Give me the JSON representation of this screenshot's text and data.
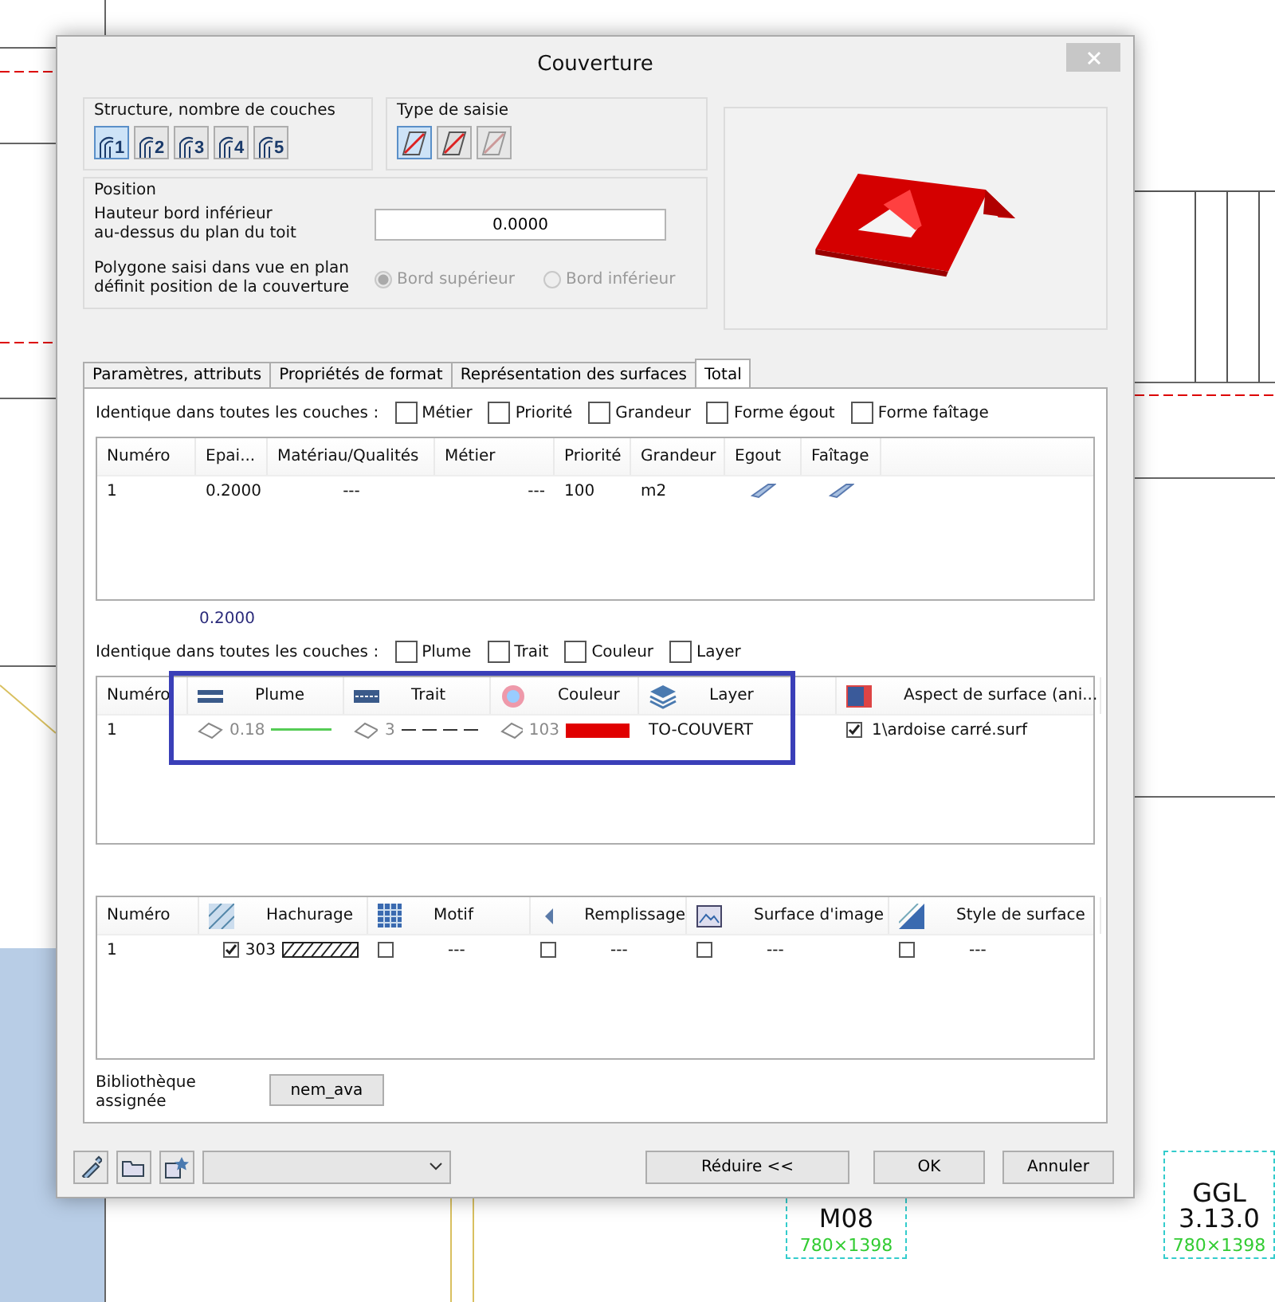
{
  "window": {
    "title": "Couverture"
  },
  "structure": {
    "label": "Structure, nombre de couches",
    "buttons": [
      {
        "label": "1",
        "selected": true
      },
      {
        "label": "2",
        "selected": false
      },
      {
        "label": "3",
        "selected": false
      },
      {
        "label": "4",
        "selected": false
      },
      {
        "label": "5",
        "selected": false
      }
    ]
  },
  "entry_type": {
    "label": "Type de saisie",
    "buttons": [
      {
        "selected": true,
        "disabled": false
      },
      {
        "selected": false,
        "disabled": false
      },
      {
        "selected": false,
        "disabled": true
      }
    ]
  },
  "position": {
    "label": "Position",
    "height_label": "Hauteur bord inférieur\nau-dessus du plan du toit",
    "height_value": "0.0000",
    "polygon_label": "Polygone saisi dans vue en plan\ndéfinit position de la couverture",
    "disabled": true,
    "radios": [
      {
        "label": "Bord supérieur",
        "selected": true
      },
      {
        "label": "Bord inférieur",
        "selected": false
      }
    ]
  },
  "tabs": [
    {
      "label": "Paramètres, attributs",
      "selected": false
    },
    {
      "label": "Propriétés de format",
      "selected": false
    },
    {
      "label": "Représentation des surfaces",
      "selected": false
    },
    {
      "label": "Total",
      "selected": true
    }
  ],
  "identical_1": {
    "label": "Identique dans toutes les couches :",
    "options": [
      {
        "label": "Métier",
        "checked": false
      },
      {
        "label": "Priorité",
        "checked": false
      },
      {
        "label": "Grandeur",
        "checked": false
      },
      {
        "label": "Forme égout",
        "checked": false
      },
      {
        "label": "Forme faîtage",
        "checked": false
      }
    ]
  },
  "layers_table": {
    "columns": [
      "Numéro",
      "Epai...",
      "Matériau/Qualités",
      "Métier",
      "Priorité",
      "Grandeur",
      "Egout",
      "Faîtage"
    ],
    "rows": [
      [
        {
          "kind": "text",
          "text": "1"
        },
        {
          "kind": "text",
          "text": "0.2000"
        },
        {
          "kind": "center",
          "text": "---"
        },
        {
          "kind": "right",
          "text": "---"
        },
        {
          "kind": "text",
          "text": "100"
        },
        {
          "kind": "text",
          "text": "m2"
        },
        {
          "kind": "shape"
        },
        {
          "kind": "shape"
        }
      ]
    ]
  },
  "total": "0.2000",
  "identical_2": {
    "label": "Identique dans toutes les couches :",
    "options": [
      {
        "label": "Plume",
        "checked": false
      },
      {
        "label": "Trait",
        "checked": false
      },
      {
        "label": "Couleur",
        "checked": false
      },
      {
        "label": "Layer",
        "checked": false
      }
    ]
  },
  "format_table": {
    "columns": [
      "Numéro",
      "Plume",
      "Trait",
      "Couleur",
      "Layer",
      "Aspect de surface (ani..."
    ],
    "rows": [
      [
        {
          "kind": "text",
          "text": "1"
        },
        {
          "kind": "pen",
          "text": "0.18"
        },
        {
          "kind": "line",
          "text": "3"
        },
        {
          "kind": "color",
          "text": "103",
          "color": "#e00000"
        },
        {
          "kind": "text",
          "text": "TO-COUVERT"
        },
        {
          "kind": "check",
          "checked": true,
          "text": "1\\ardoise carré.surf"
        }
      ]
    ],
    "highlighted": true
  },
  "surface_table": {
    "columns": [
      "Numéro",
      "Hachurage",
      "Motif",
      "Remplissage",
      "Surface d'image",
      "Style de surface"
    ],
    "rows": [
      [
        {
          "kind": "text",
          "text": "1"
        },
        {
          "kind": "hatch",
          "checked": true,
          "text": "303"
        },
        {
          "kind": "check",
          "checked": false,
          "text": "---"
        },
        {
          "kind": "check",
          "checked": false,
          "text": "---"
        },
        {
          "kind": "check",
          "checked": false,
          "text": "---"
        },
        {
          "kind": "check",
          "checked": false,
          "text": "---"
        }
      ]
    ]
  },
  "library": {
    "label": "Bibliothèque\nassignée",
    "value": "nem_ava"
  },
  "footer": {
    "buttons": [
      "Réduire <<",
      "OK",
      "Annuler"
    ]
  },
  "plan_labels": [
    {
      "lines": [
        "M08"
      ],
      "size": "780×1398"
    },
    {
      "lines": [
        "GGL",
        "3.13.0"
      ],
      "size": "780×1398"
    }
  ]
}
